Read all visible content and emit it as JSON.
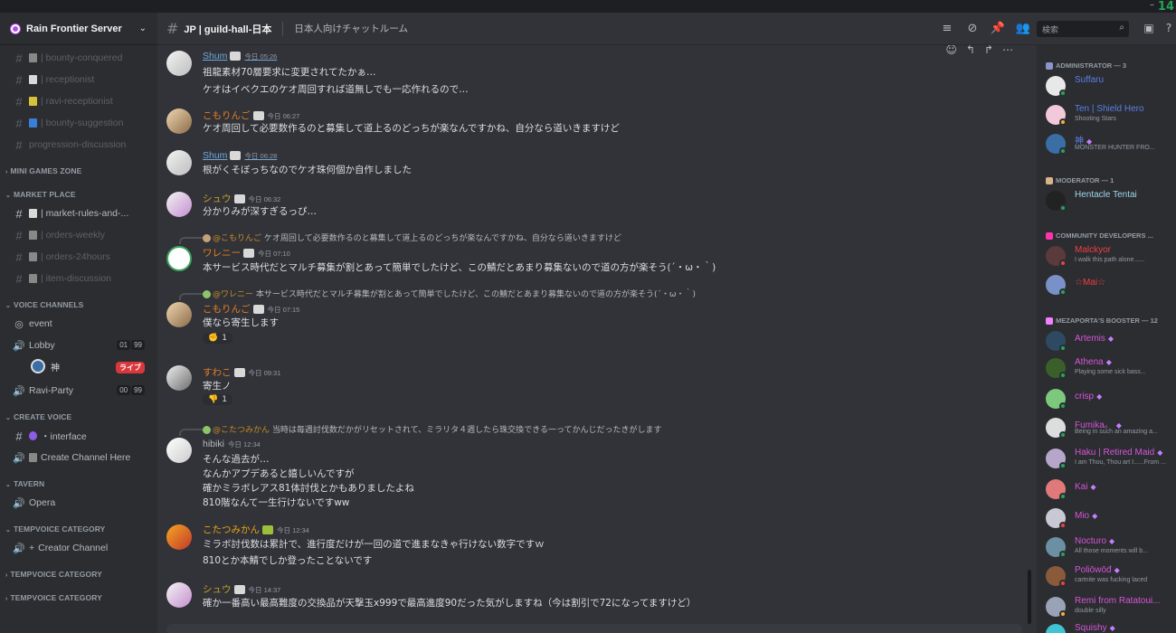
{
  "window": {
    "minimize": "–",
    "clock": "14"
  },
  "server": {
    "name": "Rain Frontier Server"
  },
  "sidebar": {
    "channels_top": [
      {
        "name": "| bounty-conquered"
      },
      {
        "name": "| receptionist"
      },
      {
        "name": "| ravi-receptionist"
      },
      {
        "name": "| bounty-suggestion"
      },
      {
        "name": "progression-discussion"
      }
    ],
    "categories": {
      "mini_games": "MINI GAMES ZONE",
      "market": "MARKET PLACE",
      "voice": "VOICE CHANNELS",
      "create_voice": "CREATE VOICE",
      "tavern": "TAVERN",
      "tempvoice1": "TEMPVOICE CATEGORY",
      "tempvoice2": "TEMPVOICE CATEGORY",
      "tempvoice3": "TEMPVOICE CATEGORY"
    },
    "market_channels": [
      {
        "name": "| market-rules-and-..."
      },
      {
        "name": "| orders-weekly"
      },
      {
        "name": "| orders-24hours"
      },
      {
        "name": "| item-discussion"
      }
    ],
    "voice": {
      "event": "event",
      "lobby": "Lobby",
      "lobby_count": "01",
      "lobby_limit": "99",
      "lobby_user": "神",
      "live": "ライブ",
      "ravi": "Ravi-Party",
      "ravi_count": "00",
      "ravi_limit": "99"
    },
    "create": {
      "interface": "・interface",
      "create_here": "Create Channel Here"
    },
    "tavern": {
      "opera": "Opera"
    },
    "tempvoice": {
      "creator": "Creator Channel"
    }
  },
  "header": {
    "channel": "JP | guild-hall-日本",
    "topic": "日本人向けチャットルーム",
    "search_placeholder": "検索"
  },
  "messages": [
    {
      "user": "Shum",
      "time": "今日 05:26",
      "lines": [
        "祖龍素材70層要求に変更されてたかぁ…",
        "ケオはイベクエのケオ周回すれば道無しでも一応作れるので…"
      ]
    },
    {
      "user": "こもりんご",
      "time": "今日 06:27",
      "lines": [
        "ケオ周回して必要数作るのと募集して道上るのどっちが楽なんですかね、自分なら道いきますけど"
      ]
    },
    {
      "user": "Shum",
      "time": "今日 06:28",
      "lines": [
        "根がくそぼっちなのでケオ珠何個か自作しました"
      ]
    },
    {
      "user": "シュウ",
      "time": "今日 06:32",
      "lines": [
        "分かりみが深すぎるっぴ…"
      ]
    },
    {
      "reply_user": "@こもりんご",
      "reply_text": "ケオ周回して必要数作るのと募集して道上るのどっちが楽なんですかね、自分なら道いきますけど",
      "user": "ワレニー",
      "time": "今日 07:10",
      "lines": [
        "本サービス時代だとマルチ募集が割とあって簡単でしたけど、この鯖だとあまり募集ないので道の方が楽そう(´・ω・｀)"
      ]
    },
    {
      "reply_user": "@ワレニー",
      "reply_text": "本サービス時代だとマルチ募集が割とあって簡単でしたけど、この鯖だとあまり募集ないので道の方が楽そう(´・ω・｀)",
      "user": "こもりんご",
      "time": "今日 07:15",
      "lines": [
        "僕なら寄生します"
      ],
      "reaction": "1"
    },
    {
      "user": "すわこ",
      "time": "今日 09:31",
      "lines": [
        "寄生ノ"
      ],
      "reaction": "1"
    },
    {
      "reply_user": "@こたつみかん",
      "reply_text": "当時は毎週討伐数だかがリセットされて、ミラリタ４週したら珠交換できる一ってかんじだったきがします",
      "user": "hibiki",
      "time": "今日 12:34",
      "lines": [
        "そんな過去が…",
        "なんかアプデあると嬉しいんですが",
        "確かミラボレアス81体討伐とかもありましたよね",
        "810階なんて一生行けないですww"
      ]
    },
    {
      "user": "こたつみかん",
      "time": "今日 12:34",
      "lines": [
        "ミラボ討伐数は累計で、進行度だけが一回の道で進まなきゃ行けない数字ですｗ",
        "810とか本鯖でしか登ったことないです"
      ]
    },
    {
      "user": "シュウ",
      "time": "今日 14:37",
      "lines": [
        "確か一番高い最高難度の交換品が天撃玉x999で最高進度90だった気がしますね（今は割引で72になってますけど）"
      ]
    }
  ],
  "members": {
    "admin_cat": "ADMINISTRATOR — 3",
    "mod_cat": "MODERATOR — 1",
    "dev_cat": "COMMUNITY DEVELOPERS ...",
    "boost_cat": "MEZAPORTA'S BOOSTER — 12",
    "list": [
      {
        "name": "Suffaru",
        "sub": ""
      },
      {
        "name": "Ten | Shield Hero",
        "sub": "Shooting Stars"
      },
      {
        "name": "神",
        "sub": "MONSTER HUNTER FRO..."
      },
      {
        "name": "Hentacle Tentai",
        "sub": ""
      },
      {
        "name": "Malckyor",
        "sub": "I walk this path alone......"
      },
      {
        "name": "☆Mai☆",
        "sub": ""
      },
      {
        "name": "Artemis",
        "sub": ""
      },
      {
        "name": "Athena",
        "sub": "Playing some sick bass..."
      },
      {
        "name": "crisp",
        "sub": ""
      },
      {
        "name": "Fumika。",
        "sub": "Being in such an amazing a..."
      },
      {
        "name": "Haku | Retired Maid",
        "sub": "I am Thou, Thou art I......From ..."
      },
      {
        "name": "Kai",
        "sub": ""
      },
      {
        "name": "Mio",
        "sub": ""
      },
      {
        "name": "Nocturo",
        "sub": "All those moments will b..."
      },
      {
        "name": "Poliōwōđ",
        "sub": "cartnite was fucking laced"
      },
      {
        "name": "Remi from Ratatoui...",
        "sub": "double silly"
      },
      {
        "name": "Squishy",
        "sub": ""
      }
    ]
  },
  "colors": {
    "bg": "#313338",
    "sidebar": "#2b2d31",
    "accent": "#5865f2"
  }
}
